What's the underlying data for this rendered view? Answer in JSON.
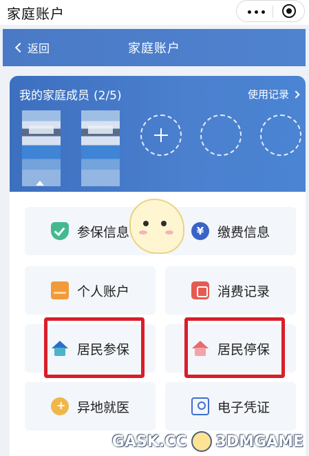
{
  "app": {
    "title": "家庭账户"
  },
  "nav": {
    "back_label": "返回",
    "title": "家庭账户"
  },
  "members": {
    "title": "我的家庭成员",
    "count": "(2/5)",
    "usage_label": "使用记录"
  },
  "tiles": [
    {
      "label": "参保信息",
      "icon": "shield-check-icon"
    },
    {
      "label": "缴费信息",
      "icon": "yen-coin-icon"
    },
    {
      "label": "个人账户",
      "icon": "wallet-icon"
    },
    {
      "label": "消费记录",
      "icon": "bill-icon"
    },
    {
      "label": "居民参保",
      "icon": "house-insure-icon"
    },
    {
      "label": "居民停保",
      "icon": "house-stop-icon"
    },
    {
      "label": "异地就医",
      "icon": "medical-icon"
    },
    {
      "label": "电子凭证",
      "icon": "id-card-icon"
    }
  ],
  "watermark": {
    "left": "GASK.CC",
    "right": "3DMGAME"
  },
  "colors": {
    "nav": "#4a7ac6",
    "highlight": "#d81e2a",
    "tile_bg": "#f3f6fa"
  }
}
